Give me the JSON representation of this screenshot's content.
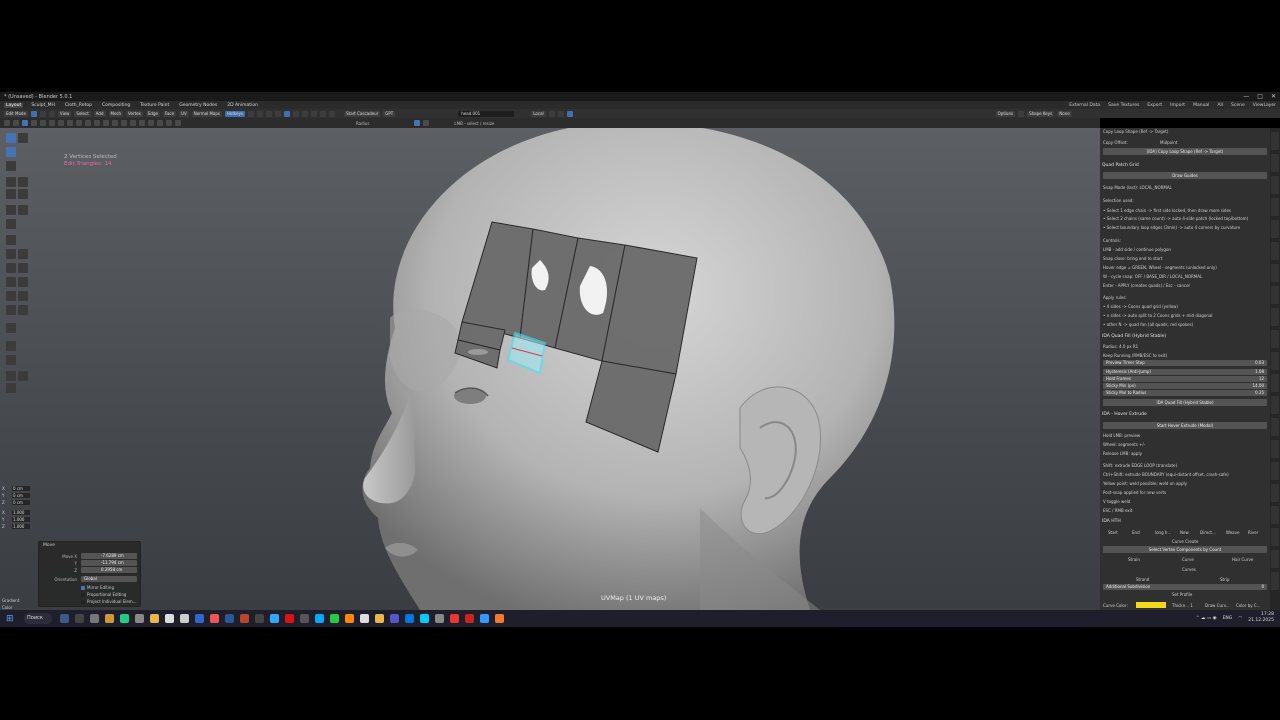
{
  "window": {
    "title": "* (Unsaved) - Blender 5.0.1",
    "controls": [
      "—",
      "□",
      "✕"
    ]
  },
  "workspace_tabs": [
    "Layout",
    "Sculpt_MH",
    "Cloth_Retop",
    "Compositing",
    "Texture Paint",
    "Geometry Nodes",
    "2D Animation"
  ],
  "active_workspace_index": 0,
  "top_right": {
    "external_data": "External Data",
    "save_textures": "Save Textures",
    "export": "Export",
    "import": "Import",
    "manual": "Manual",
    "all": "All",
    "scene": "Scene",
    "view_layer": "ViewLayer"
  },
  "header": {
    "mode": "Edit Mode",
    "menus": [
      "View",
      "Select",
      "Add",
      "Mesh",
      "Vertex",
      "Edge",
      "Face",
      "UV",
      "Normal Maps"
    ],
    "hotkeys": "Hotkeys",
    "object_field": "head.001",
    "orientation": "Local",
    "start_cascadeur": "Start Cascadeur",
    "gpt": "GPT",
    "options": "Options",
    "shape_keys": "Shape Keys",
    "none": "None"
  },
  "tool_header": {
    "radius_hint": "Radius",
    "status_hint": "LMB - select / resize"
  },
  "viewport": {
    "stats_selected": "2 Vertices Selected",
    "stats_triangles": "Edit Triangles: 14",
    "uvmap_label": "UVMap (1 UV maps)"
  },
  "transform": {
    "rows": [
      {
        "label": "X",
        "value": "0 cm"
      },
      {
        "label": "Y",
        "value": "0 cm"
      },
      {
        "label": "Z",
        "value": "0 cm"
      },
      {
        "label": "X",
        "value": "1.000"
      },
      {
        "label": "Y",
        "value": "1.000"
      },
      {
        "label": "Z",
        "value": "1.000"
      }
    ],
    "gradient": "Gradient",
    "color": "Color"
  },
  "operator_panel": {
    "title": "Move",
    "move_x_label": "Move X",
    "move_x": "-7.6289 cm",
    "move_y_label": "Y",
    "move_y": "-11.794 cm",
    "move_z_label": "Z",
    "move_z": "0.2958 cm",
    "orientation_label": "Orientation",
    "orientation": "Global",
    "mirror_editing": "Mirror Editing",
    "proportional_editing": "Proportional Editing",
    "project_individual": "Project Individual Elem..."
  },
  "sidebar": {
    "copy_loop_shape": "Copy Loop Shape (Ref -> Target)",
    "copy_offset_label": "Copy Offset:",
    "copy_offset_value": "Midpoint",
    "copy_loop_button": "[IDA] Copy Loop Shape (Ref -> Target)",
    "quad_patch_grid": "Quad Patch Grid",
    "draw_guides": "Draw Guides",
    "snap_mode": "Snap Mode (last): LOCAL_NORMAL",
    "selection_used": "Selection used:",
    "sel_lines": [
      "• Select 1 edge chain -> first side locked, then draw more sides",
      "• Select 2 chains (same count) -> auto 4-side patch (locked top/bottom)",
      "• Select boundary loop edges (3min) -> auto 4 corners by curvature"
    ],
    "controls": "Controls:",
    "ctrl_lines": [
      "LMB - add side / continue polygon",
      "Snap close: bring end to start",
      "Hover edge = GREEN, Wheel - segments (unlocked only)",
      "W - cycle snap: OFF / BASE_DIR / LOCAL_NORMAL",
      "Enter - APPLY (creates quads) / Esc - cancel"
    ],
    "apply_rules": "Apply rules:",
    "apply_lines": [
      "• 4 sides -> Coons quad grid (yellow)",
      "• n sides -> auto split to 2 Coons grids + mid diagonal",
      "• other N -> quad fan (all quads, red spokes)"
    ],
    "ida_quad_fill": "IDA Quad Fill (Hybrid Stable)",
    "radius": "Radius: 4.0 px R1",
    "keep_running": "Keep Running (RMB/ESC to exit)",
    "preview_timer": "Preview Timer Step",
    "preview_timer_val": "0.03",
    "hysteresis": "Hysteresis (Anti-Jump)",
    "hysteresis_val": "1.08",
    "hold_frames": "Hold Frames",
    "hold_frames_val": "12",
    "sticky_min": "Sticky Min (px)",
    "sticky_min_val": "14.00",
    "sticky_mul": "Sticky Mul to Radius",
    "sticky_mul_val": "0.35",
    "quad_fill_button": "IDA Quad Fill (Hybrid Stable)",
    "hover_extrude": "IDA - Hover Extrude",
    "start_hover_extrude": "Start Hover Extrude (Modal)",
    "hover_lines": [
      "Hold LMB: preview",
      "Wheel: segments +/-",
      "Release LMB: apply",
      "",
      "Shift: extrude EDGE LOOP (translate)",
      "Ctrl+Shift: extrude BOUNDARY (equi-distant offset, crash-safe)",
      "Yellow point: weld possible; weld on apply",
      "Post-snap applied for new verts",
      "V toggle weld",
      "ESC / RMB exit"
    ],
    "ida_hth": "IDA HTH",
    "hth_row": [
      "Start",
      "End",
      "long h...",
      "New",
      "Direct...",
      "Weave",
      "River"
    ],
    "curve_create": "Curve Create",
    "select_vertex_components": "Select Vertex Components by Count",
    "strain": "Strain",
    "curve": "Curve",
    "hair_curve": "Hair Curve",
    "curves": "Curves",
    "strand": "Strand",
    "strip": "Strip",
    "additional_subdivision": "Additional Subdivision",
    "additional_subdivision_val": "0",
    "set_profile": "Set Profile",
    "curve_color_label": "Curve Color:",
    "thickness": "Thickn... 1",
    "draw_curve": "Draw Curv...",
    "color_by": "Color by C..."
  },
  "taskbar": {
    "search": "Поиск",
    "lang": "ENG",
    "time": "17:28",
    "date": "21.12.2025"
  },
  "colors": {
    "accent": "#4772b3",
    "stats_pink": "#e86aa6",
    "selection_cyan": "#3fe3ff",
    "curve_yellow": "#f2d81c"
  }
}
